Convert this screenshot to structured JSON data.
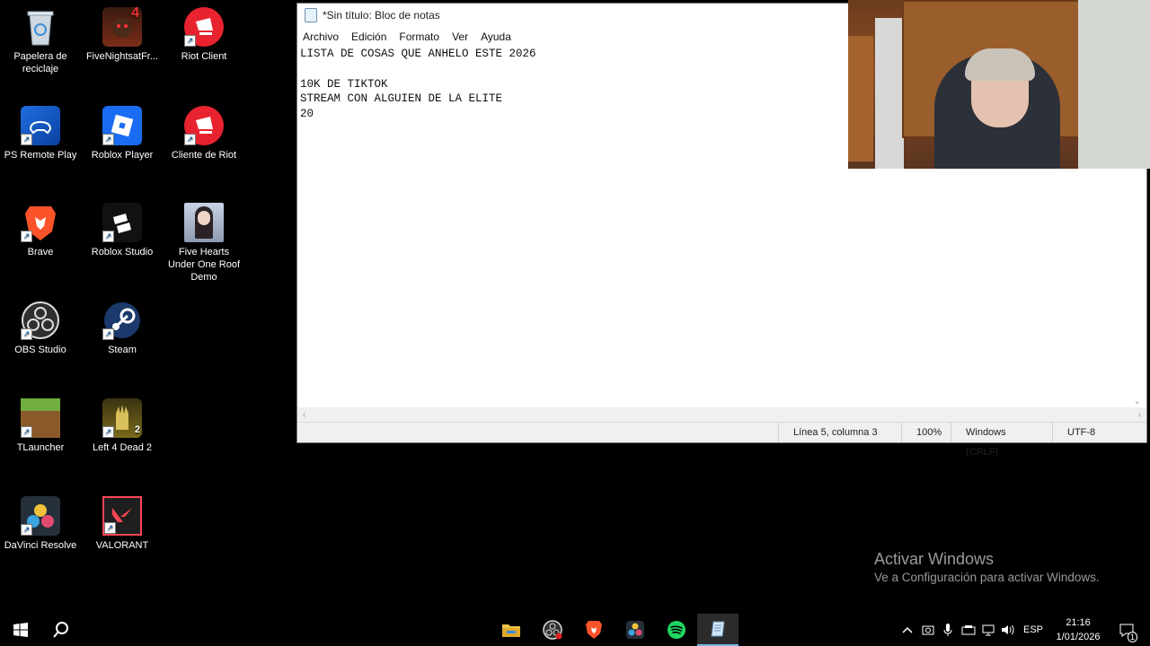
{
  "desktop": {
    "icons": [
      {
        "label": "Papelera de reciclaje",
        "icon": "recycle-bin-icon"
      },
      {
        "label": "FiveNightsatFr...",
        "icon": "fnaf-icon"
      },
      {
        "label": "Riot Client",
        "icon": "riot-icon"
      },
      {
        "label": "PS Remote Play",
        "icon": "ps-remote-play-icon"
      },
      {
        "label": "Roblox Player",
        "icon": "roblox-icon"
      },
      {
        "label": "Cliente de Riot",
        "icon": "riot-icon"
      },
      {
        "label": "Brave",
        "icon": "brave-icon"
      },
      {
        "label": "Roblox Studio",
        "icon": "roblox-studio-icon"
      },
      {
        "label": "Five Hearts Under One Roof Demo",
        "icon": "game-cover-icon"
      },
      {
        "label": "OBS Studio",
        "icon": "obs-icon"
      },
      {
        "label": "Steam",
        "icon": "steam-icon"
      },
      {
        "label": "TLauncher",
        "icon": "minecraft-icon"
      },
      {
        "label": "Left 4 Dead 2",
        "icon": "l4d2-icon"
      },
      {
        "label": "DaVinci Resolve",
        "icon": "davinci-icon"
      },
      {
        "label": "VALORANT",
        "icon": "valorant-icon"
      }
    ]
  },
  "notepad": {
    "title": "*Sin título: Bloc de notas",
    "menu": [
      "Archivo",
      "Edición",
      "Formato",
      "Ver",
      "Ayuda"
    ],
    "text": "LISTA DE COSAS QUE ANHELO ESTE 2026\n\n10K DE TIKTOK\nSTREAM CON ALGUIEN DE LA ELITE\n20",
    "status": {
      "position": "Línea 5, columna 3",
      "zoom": "100%",
      "line_ending": "Windows (CRLF)",
      "encoding": "UTF-8"
    }
  },
  "watermark": {
    "title": "Activar Windows",
    "subtitle": "Ve a Configuración para activar Windows."
  },
  "taskbar": {
    "apps": [
      "file-explorer-icon",
      "obs-icon",
      "brave-icon",
      "davinci-icon",
      "spotify-icon",
      "notepad-icon"
    ],
    "language": "ESP",
    "time": "21:16",
    "date": "1/01/2026",
    "notification_count": "1"
  }
}
